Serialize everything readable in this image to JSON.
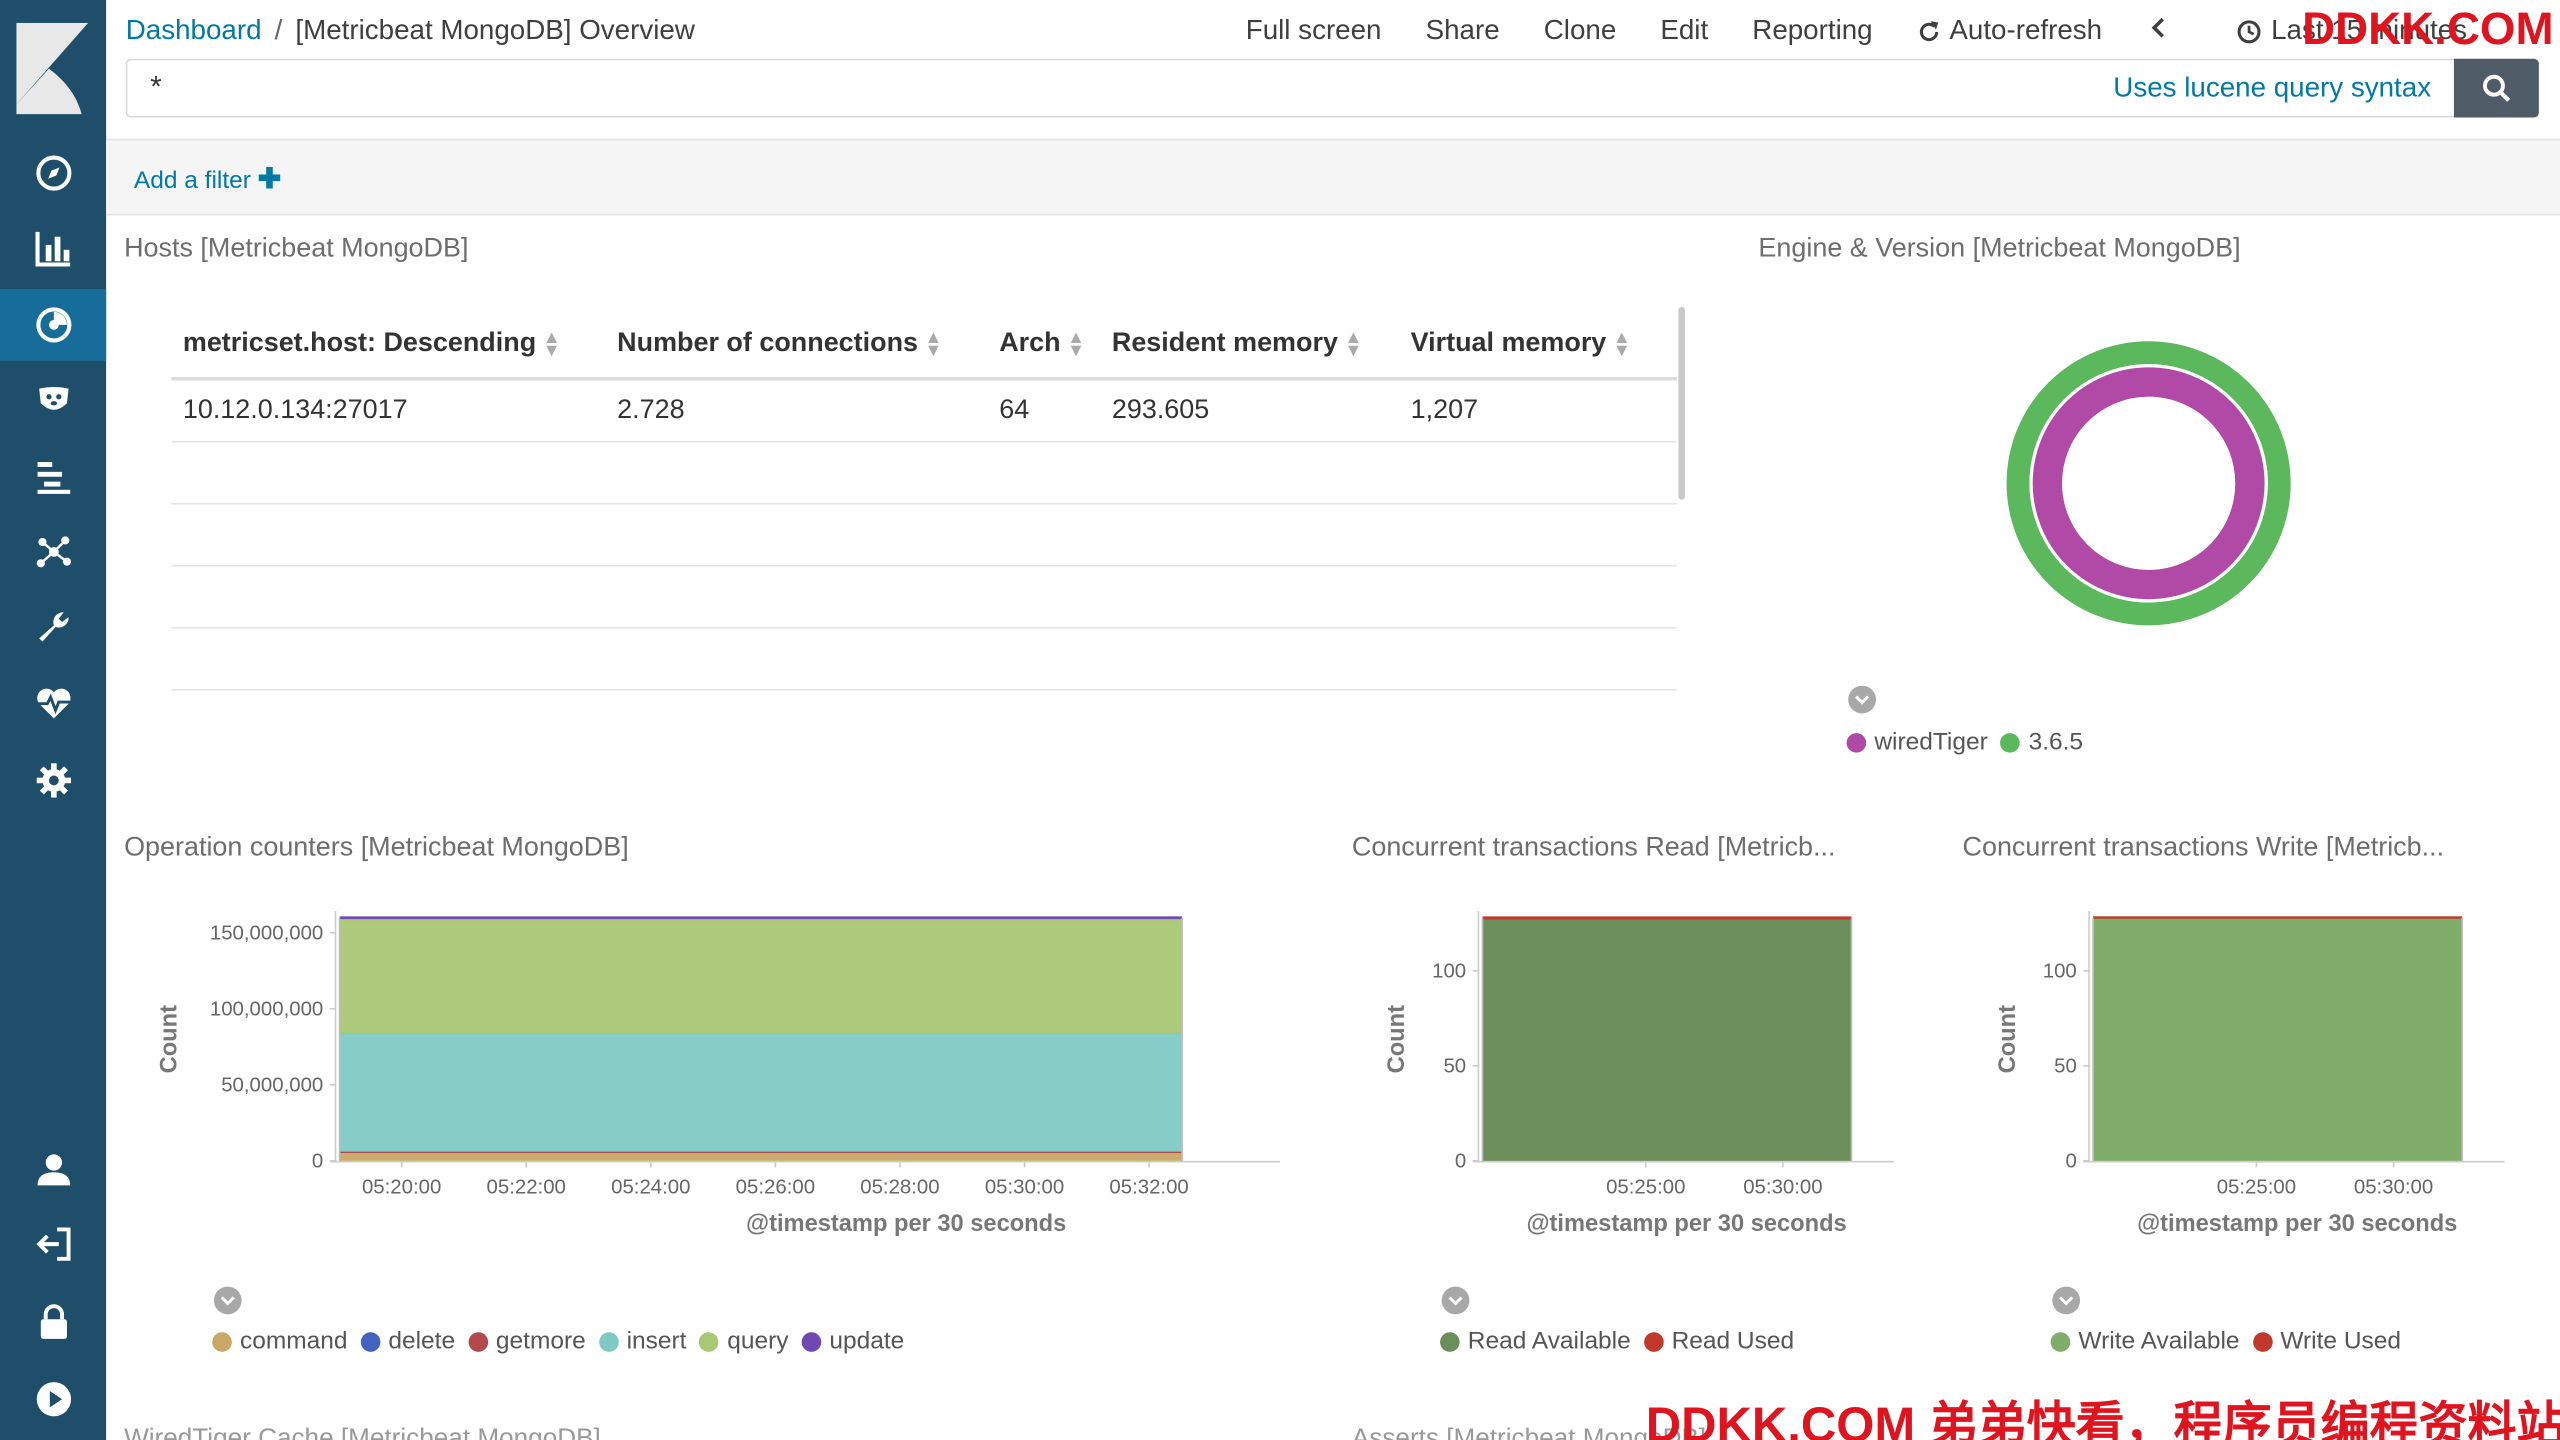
{
  "header": {
    "breadcrumb_root": "Dashboard",
    "breadcrumb_sep": "/",
    "breadcrumb_current": "[Metricbeat MongoDB] Overview",
    "menu": [
      "Full screen",
      "Share",
      "Clone",
      "Edit",
      "Reporting"
    ],
    "auto_refresh": "Auto-refresh",
    "time_range": "Last 15 minutes"
  },
  "query": {
    "value": "*",
    "syntax_link": "Uses lucene query syntax"
  },
  "filter": {
    "add_label": "Add a filter"
  },
  "watermark": {
    "top": "DDKK.COM",
    "bottom": "DDKK.COM 弟弟快看，程序员编程资料站"
  },
  "hosts_panel": {
    "title": "Hosts [Metricbeat MongoDB]",
    "columns": [
      "metricset.host: Descending",
      "Number of connections",
      "Arch",
      "Resident memory",
      "Virtual memory"
    ],
    "rows": [
      [
        "10.12.0.134:27017",
        "2.728",
        "64",
        "293.605",
        "1,207"
      ]
    ]
  },
  "engine_panel": {
    "title": "Engine & Version [Metricbeat MongoDB]",
    "legend": [
      {
        "label": "wiredTiger",
        "color": "#b14aa6"
      },
      {
        "label": "3.6.5",
        "color": "#5cb85c"
      }
    ]
  },
  "op_panel": {
    "title": "Operation counters [Metricbeat MongoDB]"
  },
  "read_panel": {
    "title": "Concurrent transactions Read [Metricb..."
  },
  "write_panel": {
    "title": "Concurrent transactions Write [Metricb..."
  },
  "below_titles": [
    "WiredTiger Cache [Metricbeat MongoDB]",
    "Asserts [Metricbeat MongoDB]"
  ],
  "chart_data": [
    {
      "type": "pie",
      "title": "Engine & Version [Metricbeat MongoDB]",
      "rings": [
        {
          "name": "engine",
          "slices": [
            {
              "label": "wiredTiger",
              "value": 1,
              "color": "#b14aa6"
            }
          ]
        },
        {
          "name": "version",
          "slices": [
            {
              "label": "3.6.5",
              "value": 1,
              "color": "#5cb85c"
            }
          ]
        }
      ]
    },
    {
      "type": "area",
      "title": "Operation counters [Metricbeat MongoDB]",
      "xlabel": "@timestamp per 30 seconds",
      "ylabel": "Count",
      "ylim": [
        0,
        160000000
      ],
      "yticks": [
        0,
        50000000,
        100000000,
        150000000
      ],
      "ytick_labels": [
        "0",
        "50,000,000",
        "100,000,000",
        "150,000,000"
      ],
      "xticks": [
        "05:20:00",
        "05:22:00",
        "05:24:00",
        "05:26:00",
        "05:28:00",
        "05:30:00",
        "05:32:00"
      ],
      "legend_position": "bottom-left",
      "series": [
        {
          "name": "command",
          "color": "#c8a867",
          "value": 6000000
        },
        {
          "name": "delete",
          "color": "#4462c0",
          "value": 0
        },
        {
          "name": "getmore",
          "color": "#b3494c",
          "value": 0
        },
        {
          "name": "insert",
          "color": "#7fc9c4",
          "value": 78000000
        },
        {
          "name": "query",
          "color": "#a9c873",
          "value": 75000000
        },
        {
          "name": "update",
          "color": "#6e49b3",
          "value": 1000000
        }
      ]
    },
    {
      "type": "area",
      "title": "Concurrent transactions Read [Metricb...",
      "xlabel": "@timestamp per 30 seconds",
      "ylabel": "Count",
      "ylim": [
        0,
        128
      ],
      "yticks": [
        0,
        50,
        100
      ],
      "xticks": [
        "05:25:00",
        "05:30:00"
      ],
      "series": [
        {
          "name": "Read Available",
          "color": "#6b8e5a",
          "value": 127
        },
        {
          "name": "Read Used",
          "color": "#c0392b",
          "value": 1
        }
      ]
    },
    {
      "type": "area",
      "title": "Concurrent transactions Write [Metricb...",
      "xlabel": "@timestamp per 30 seconds",
      "ylabel": "Count",
      "ylim": [
        0,
        128
      ],
      "yticks": [
        0,
        50,
        100
      ],
      "xticks": [
        "05:25:00",
        "05:30:00"
      ],
      "series": [
        {
          "name": "Write Available",
          "color": "#80ad6a",
          "value": 128
        },
        {
          "name": "Write Used",
          "color": "#c0392b",
          "value": 0
        }
      ]
    }
  ]
}
